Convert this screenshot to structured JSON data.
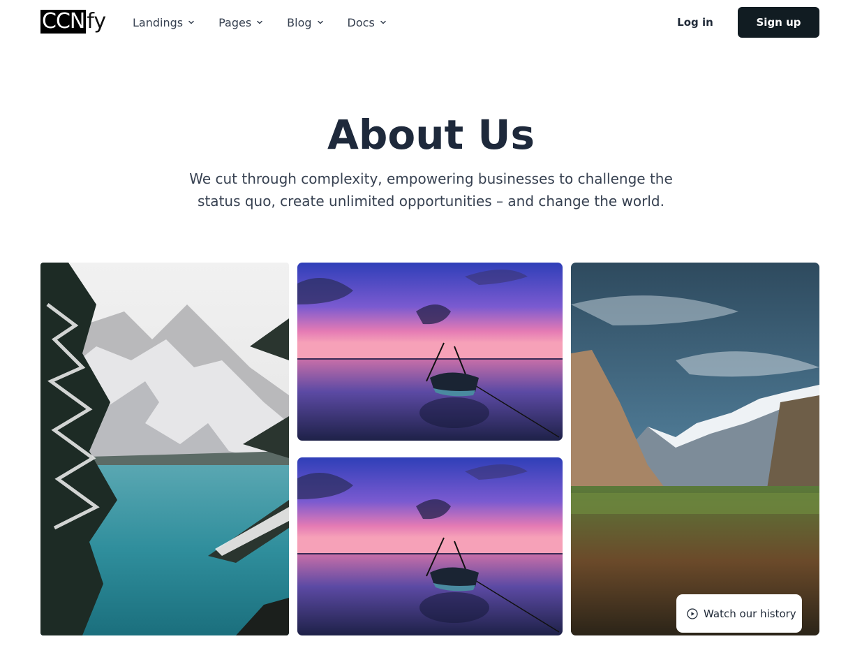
{
  "brand": {
    "logo_box": "CCN",
    "logo_rest": "fy"
  },
  "nav": {
    "items": [
      {
        "label": "Landings",
        "icon": "chevron-down-icon"
      },
      {
        "label": "Pages",
        "icon": "chevron-down-icon"
      },
      {
        "label": "Blog",
        "icon": "chevron-down-icon"
      },
      {
        "label": "Docs",
        "icon": "chevron-down-icon"
      }
    ],
    "login_label": "Log in",
    "signup_label": "Sign up"
  },
  "hero": {
    "title": "About Us",
    "subtitle_line1": "We cut through complexity, empowering businesses to challenge the",
    "subtitle_line2": "status quo, create unlimited opportunities – and change the world."
  },
  "gallery": {
    "images": [
      "snowy-mountain-lake-photo",
      "sunset-boat-photo",
      "sunset-boat-photo",
      "valley-mountains-photo"
    ],
    "watch_label": "Watch our history",
    "watch_icon": "play-circle-icon"
  },
  "colors": {
    "primary_button": "#111c22",
    "heading": "#1e293b",
    "text": "#374151"
  }
}
